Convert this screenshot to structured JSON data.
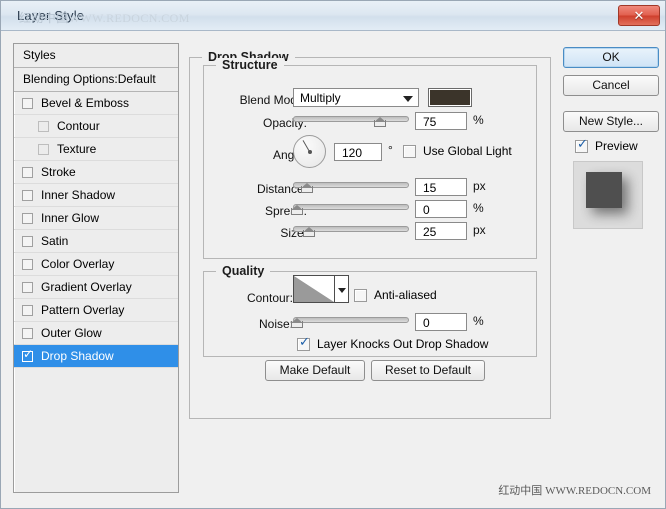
{
  "window": {
    "title": "Layer Style",
    "close_label": "✕",
    "watermark_cn": "红动中国",
    "watermark_url": "WWW.REDOCN.COM"
  },
  "styles_panel": {
    "header": "Styles",
    "blending_options": "Blending Options:Default",
    "items": [
      {
        "label": "Bevel & Emboss",
        "checked": false,
        "indent": false,
        "selected": false
      },
      {
        "label": "Contour",
        "checked": false,
        "indent": true,
        "selected": false
      },
      {
        "label": "Texture",
        "checked": false,
        "indent": true,
        "selected": false
      },
      {
        "label": "Stroke",
        "checked": false,
        "indent": false,
        "selected": false
      },
      {
        "label": "Inner Shadow",
        "checked": false,
        "indent": false,
        "selected": false
      },
      {
        "label": "Inner Glow",
        "checked": false,
        "indent": false,
        "selected": false
      },
      {
        "label": "Satin",
        "checked": false,
        "indent": false,
        "selected": false
      },
      {
        "label": "Color Overlay",
        "checked": false,
        "indent": false,
        "selected": false
      },
      {
        "label": "Gradient Overlay",
        "checked": false,
        "indent": false,
        "selected": false
      },
      {
        "label": "Pattern Overlay",
        "checked": false,
        "indent": false,
        "selected": false
      },
      {
        "label": "Outer Glow",
        "checked": false,
        "indent": false,
        "selected": false
      },
      {
        "label": "Drop Shadow",
        "checked": true,
        "indent": false,
        "selected": true
      }
    ]
  },
  "drop_shadow": {
    "group_label": "Drop Shadow",
    "structure": {
      "group_label": "Structure",
      "blend_mode_label": "Blend Mode:",
      "blend_mode_value": "Multiply",
      "shadow_color": "#3b342a",
      "opacity_label": "Opacity:",
      "opacity_value": "75",
      "opacity_unit": "%",
      "angle_label": "Angle:",
      "angle_value": "120",
      "angle_unit": "°",
      "use_global_light_label": "Use Global Light",
      "use_global_light_checked": false,
      "distance_label": "Distance:",
      "distance_value": "15",
      "distance_unit": "px",
      "spread_label": "Spread:",
      "spread_value": "0",
      "spread_unit": "%",
      "size_label": "Size:",
      "size_value": "25",
      "size_unit": "px"
    },
    "quality": {
      "group_label": "Quality",
      "contour_label": "Contour:",
      "anti_aliased_label": "Anti-aliased",
      "anti_aliased_checked": false,
      "noise_label": "Noise:",
      "noise_value": "0",
      "noise_unit": "%"
    },
    "knockout_label": "Layer Knocks Out Drop Shadow",
    "knockout_checked": true,
    "make_default_label": "Make Default",
    "reset_default_label": "Reset to Default"
  },
  "right_panel": {
    "ok_label": "OK",
    "cancel_label": "Cancel",
    "new_style_label": "New Style...",
    "preview_label": "Preview",
    "preview_checked": true
  }
}
